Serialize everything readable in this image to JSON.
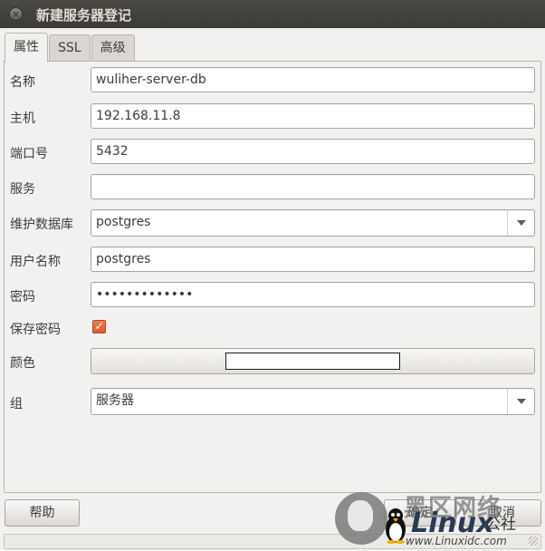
{
  "window": {
    "title": "新建服务器登记"
  },
  "tabs": [
    {
      "label": "属性"
    },
    {
      "label": "SSL"
    },
    {
      "label": "高级"
    }
  ],
  "form": {
    "name": {
      "label": "名称",
      "value": "wuliher-server-db"
    },
    "host": {
      "label": "主机",
      "value": "192.168.11.8"
    },
    "port": {
      "label": "端口号",
      "value": "5432"
    },
    "service": {
      "label": "服务",
      "value": ""
    },
    "maintenance_db": {
      "label": "维护数据库",
      "value": "postgres"
    },
    "username": {
      "label": "用户名称",
      "value": "postgres"
    },
    "password": {
      "label": "密码",
      "value": "•••••••••••••"
    },
    "save_password": {
      "label": "保存密码",
      "checked": true,
      "accent": "#e05b2b"
    },
    "color": {
      "label": "颜色",
      "swatch": "#ffffff"
    },
    "group": {
      "label": "组",
      "value": "服务器"
    }
  },
  "buttons": {
    "help": "帮助",
    "ok": "确定",
    "cancel": "取消"
  },
  "watermark": {
    "line1": "黑区网络",
    "line2": "Linux",
    "line2b": "公社",
    "line3": "www.Linuxidc.com"
  }
}
